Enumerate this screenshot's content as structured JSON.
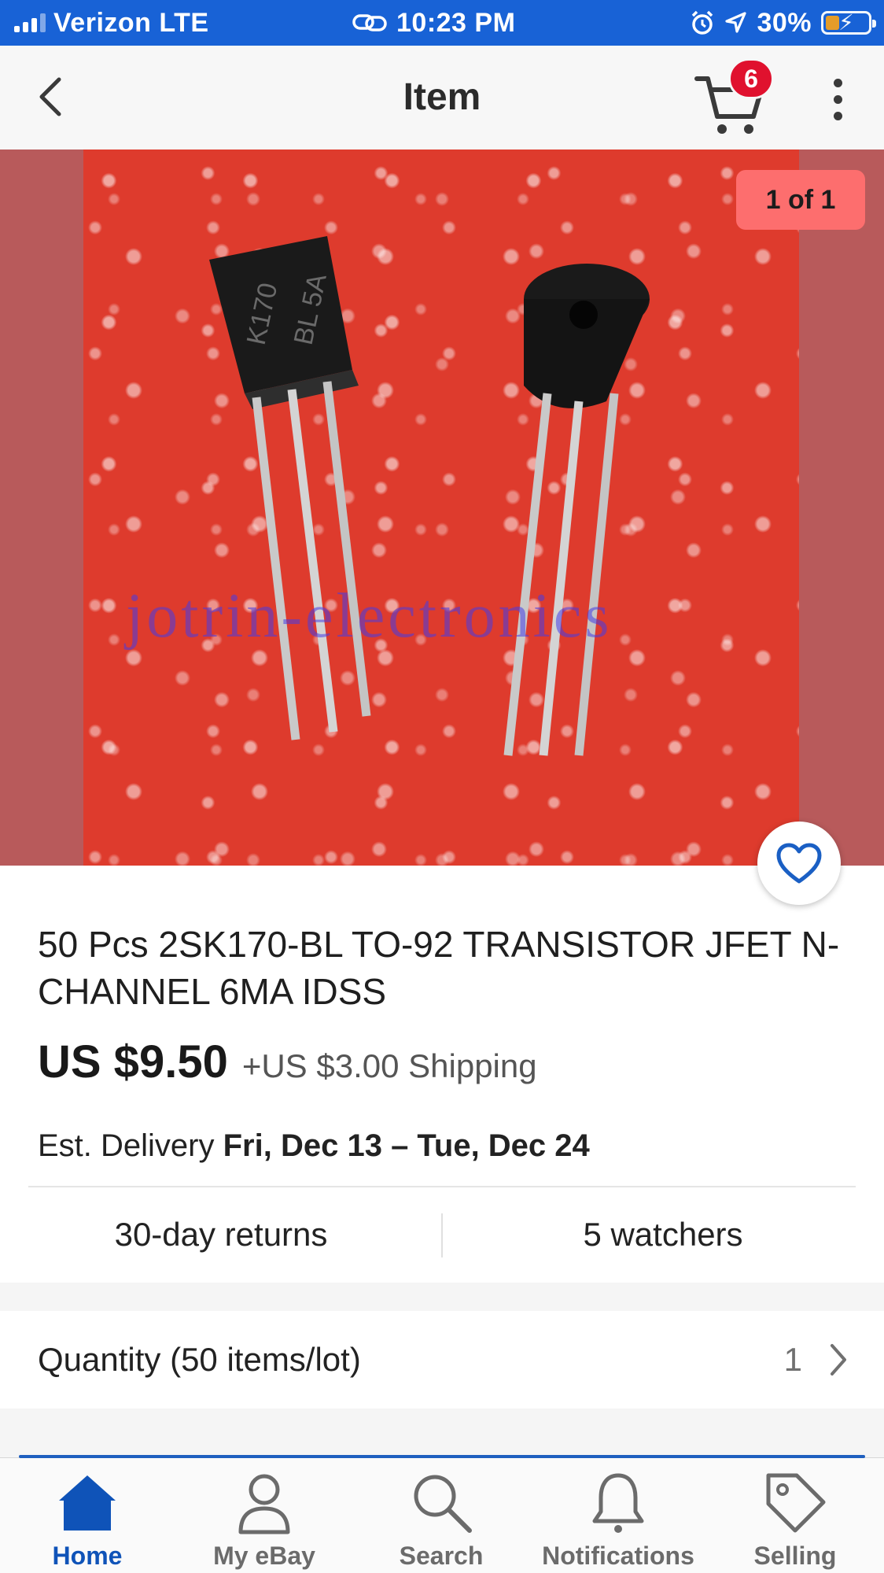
{
  "status_bar": {
    "carrier": "Verizon LTE",
    "time": "10:23 PM",
    "battery": "30%"
  },
  "header": {
    "title": "Item",
    "cart_count": "6"
  },
  "gallery": {
    "counter": "1 of 1",
    "watermark": "jotrin-electronics",
    "image_description_icon": "transistor-photo"
  },
  "item": {
    "title": "50 Pcs 2SK170-BL TO-92 TRANSISTOR JFET N-CHANNEL 6MA IDSS",
    "price": "US $9.50",
    "shipping": "+US $3.00 Shipping",
    "delivery_prefix": "Est. Delivery",
    "delivery_dates": "Fri, Dec 13 – Tue, Dec 24",
    "returns": "30-day returns",
    "watchers": "5 watchers",
    "quantity_label": "Quantity (50 items/lot)",
    "quantity_value": "1"
  },
  "bottom_nav": [
    {
      "label": "Home",
      "icon": "home-icon",
      "active": true
    },
    {
      "label": "My eBay",
      "icon": "person-icon",
      "active": false
    },
    {
      "label": "Search",
      "icon": "search-icon",
      "active": false
    },
    {
      "label": "Notifications",
      "icon": "bell-icon",
      "active": false
    },
    {
      "label": "Selling",
      "icon": "tag-icon",
      "active": false
    }
  ],
  "colors": {
    "status_bar": "#1862d6",
    "accent_blue": "#0f53b8",
    "badge_red": "#e0112e",
    "counter_bg": "#fd6e6e",
    "photo_bg": "#de3b2d"
  }
}
